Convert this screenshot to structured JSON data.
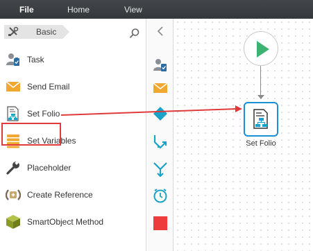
{
  "menu": {
    "items": [
      {
        "label": "File",
        "active": true
      },
      {
        "label": "Home",
        "active": false
      },
      {
        "label": "View",
        "active": false
      }
    ]
  },
  "toolbox": {
    "breadcrumb": {
      "tool_icon": "tools-icon",
      "label": "Basic"
    },
    "search_icon": "search-icon",
    "items": [
      {
        "label": "Task",
        "icon": "user-task-icon"
      },
      {
        "label": "Send Email",
        "icon": "envelope-icon"
      },
      {
        "label": "Set Folio",
        "icon": "set-folio-icon",
        "highlighted": true
      },
      {
        "label": "Set Variables",
        "icon": "variables-icon"
      },
      {
        "label": "Placeholder",
        "icon": "wrench-icon"
      },
      {
        "label": "Create Reference",
        "icon": "create-reference-icon"
      },
      {
        "label": "SmartObject Method",
        "icon": "smartobject-cube-icon"
      }
    ]
  },
  "icon_strip": {
    "collapse_icon": "chevron-left-icon",
    "items": [
      {
        "icon": "user-task-icon"
      },
      {
        "icon": "envelope-icon"
      },
      {
        "icon": "decision-diamond-icon"
      },
      {
        "icon": "split-icon"
      },
      {
        "icon": "merge-icon"
      },
      {
        "icon": "timer-icon"
      },
      {
        "icon": "end-square-icon"
      }
    ]
  },
  "canvas": {
    "start_node_icon": "play-icon",
    "step_node": {
      "label": "Set Folio",
      "icon": "set-folio-icon"
    }
  },
  "colors": {
    "menubar": "#3c4043",
    "accent_blue": "#1a8fd6",
    "start_green": "#3cb371",
    "highlight_red": "#e03a3a",
    "strip_teal": "#1aa3c8",
    "strip_orange": "#f0a830",
    "end_red": "#ee3b3b"
  }
}
